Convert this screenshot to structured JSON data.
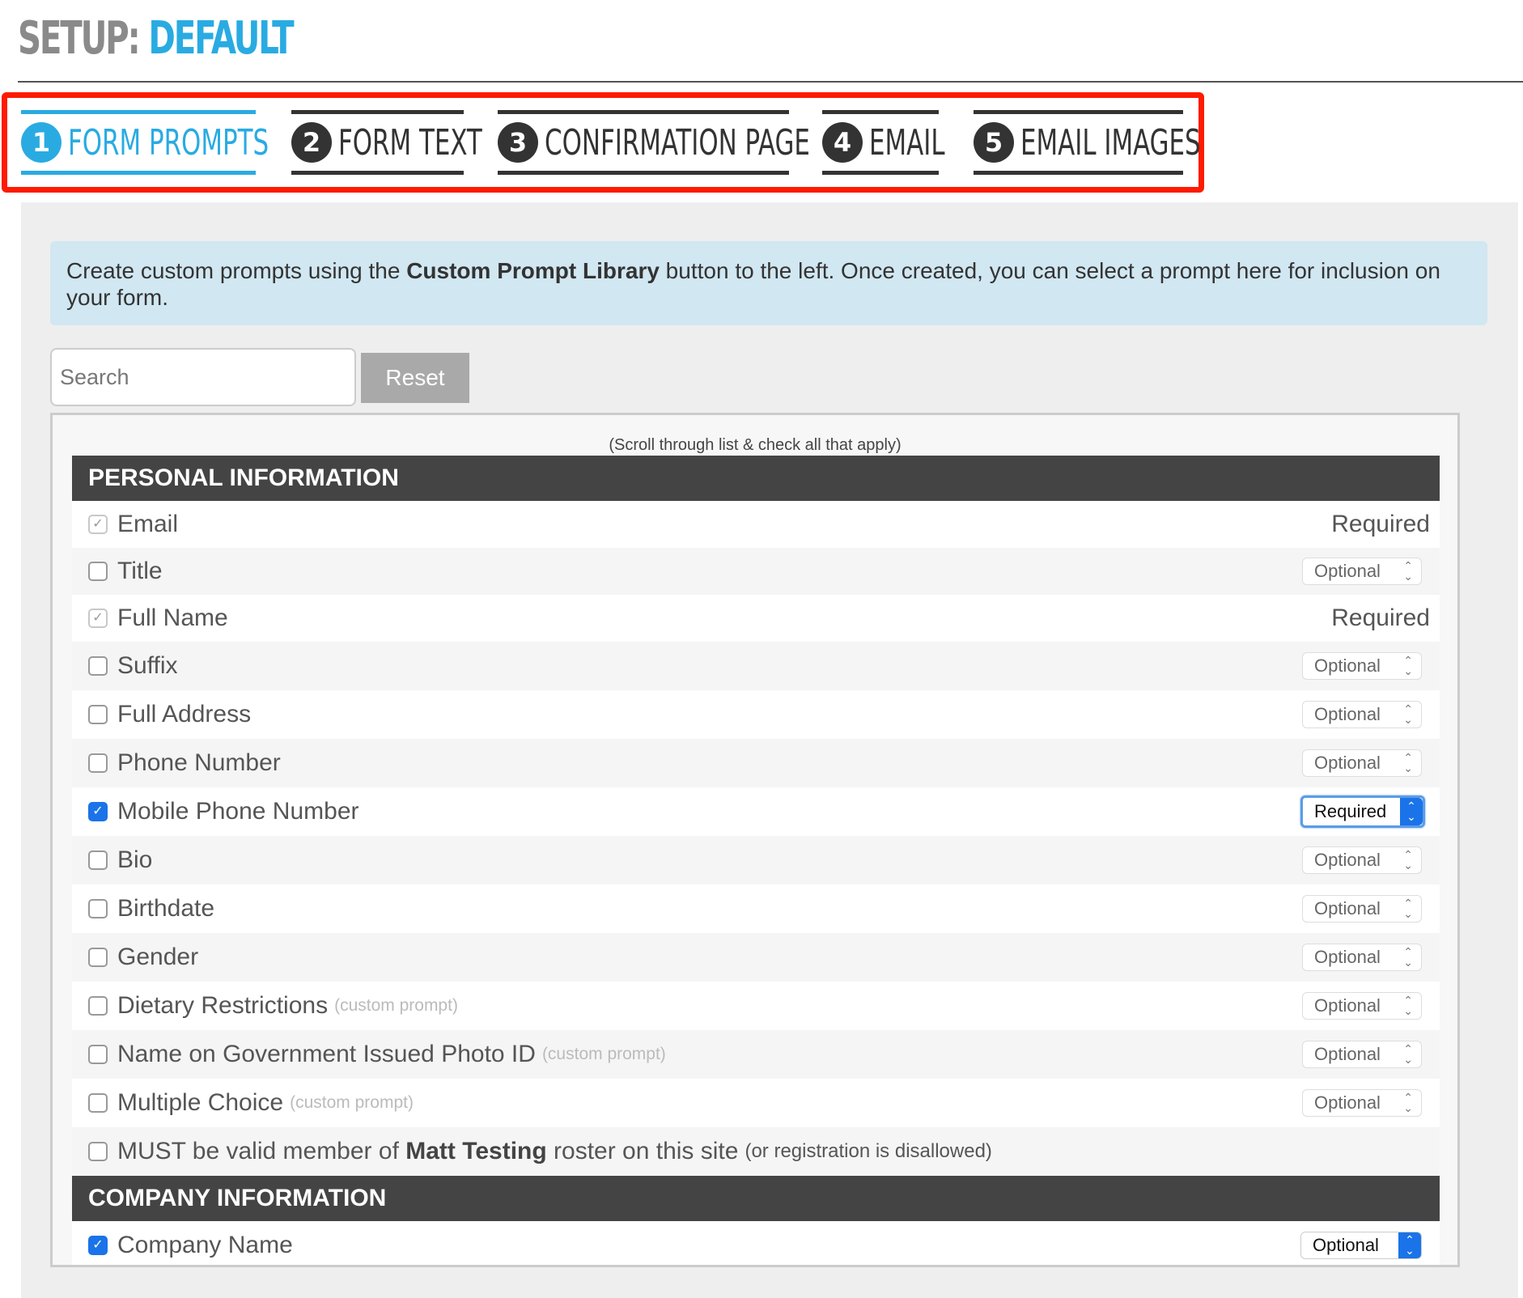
{
  "header": {
    "title_prefix": "SETUP:",
    "title_name": "DEFAULT"
  },
  "tabs": [
    {
      "num": "1",
      "label": "FORM PROMPTS",
      "active": true
    },
    {
      "num": "2",
      "label": "FORM TEXT",
      "active": false
    },
    {
      "num": "3",
      "label": "CONFIRMATION PAGE",
      "active": false
    },
    {
      "num": "4",
      "label": "EMAIL",
      "active": false
    },
    {
      "num": "5",
      "label": "EMAIL IMAGES",
      "active": false
    }
  ],
  "info": {
    "pre": "Create custom prompts using the ",
    "bold": "Custom Prompt Library",
    "post": " button to the left. Once created, you can select a prompt here for inclusion on your form."
  },
  "search": {
    "placeholder": "Search",
    "value": ""
  },
  "reset_label": "Reset",
  "scroll_hint": "(Scroll through list & check all that apply)",
  "sections": {
    "personal": {
      "title": "PERSONAL INFORMATION"
    },
    "company": {
      "title": "COMPANY INFORMATION"
    }
  },
  "prompts": [
    {
      "label": "Email",
      "note": "",
      "checked": true,
      "status": "Required",
      "locked": true
    },
    {
      "label": "Title",
      "note": "",
      "checked": false,
      "status": "Optional",
      "locked": false
    },
    {
      "label": "Full Name",
      "note": "",
      "checked": true,
      "status": "Required",
      "locked": true
    },
    {
      "label": "Suffix",
      "note": "",
      "checked": false,
      "status": "Optional",
      "locked": false
    },
    {
      "label": "Full Address",
      "note": "",
      "checked": false,
      "status": "Optional",
      "locked": false
    },
    {
      "label": "Phone Number",
      "note": "",
      "checked": false,
      "status": "Optional",
      "locked": false
    },
    {
      "label": "Mobile Phone Number",
      "note": "",
      "checked": true,
      "status": "Required",
      "locked": false
    },
    {
      "label": "Bio",
      "note": "",
      "checked": false,
      "status": "Optional",
      "locked": false
    },
    {
      "label": "Birthdate",
      "note": "",
      "checked": false,
      "status": "Optional",
      "locked": false
    },
    {
      "label": "Gender",
      "note": "",
      "checked": false,
      "status": "Optional",
      "locked": false
    },
    {
      "label": "Dietary Restrictions",
      "note": "(custom prompt)",
      "checked": false,
      "status": "Optional",
      "locked": false
    },
    {
      "label": "Name on Government Issued Photo ID",
      "note": "(custom prompt)",
      "checked": false,
      "status": "Optional",
      "locked": false
    },
    {
      "label": "Multiple Choice",
      "note": "(custom prompt)",
      "checked": false,
      "status": "Optional",
      "locked": false
    }
  ],
  "roster": {
    "pre": "MUST be valid member of ",
    "bold": "Matt Testing",
    "post": " roster on this site",
    "note": "(or registration is disallowed)",
    "checked": false
  },
  "company_prompts": [
    {
      "label": "Company Name",
      "checked": true,
      "status": "Optional"
    }
  ],
  "colors": {
    "accent": "#29abe2",
    "highlight_border": "#ff1a00",
    "section_header": "#444444",
    "info_bg": "#d1e7f1"
  }
}
